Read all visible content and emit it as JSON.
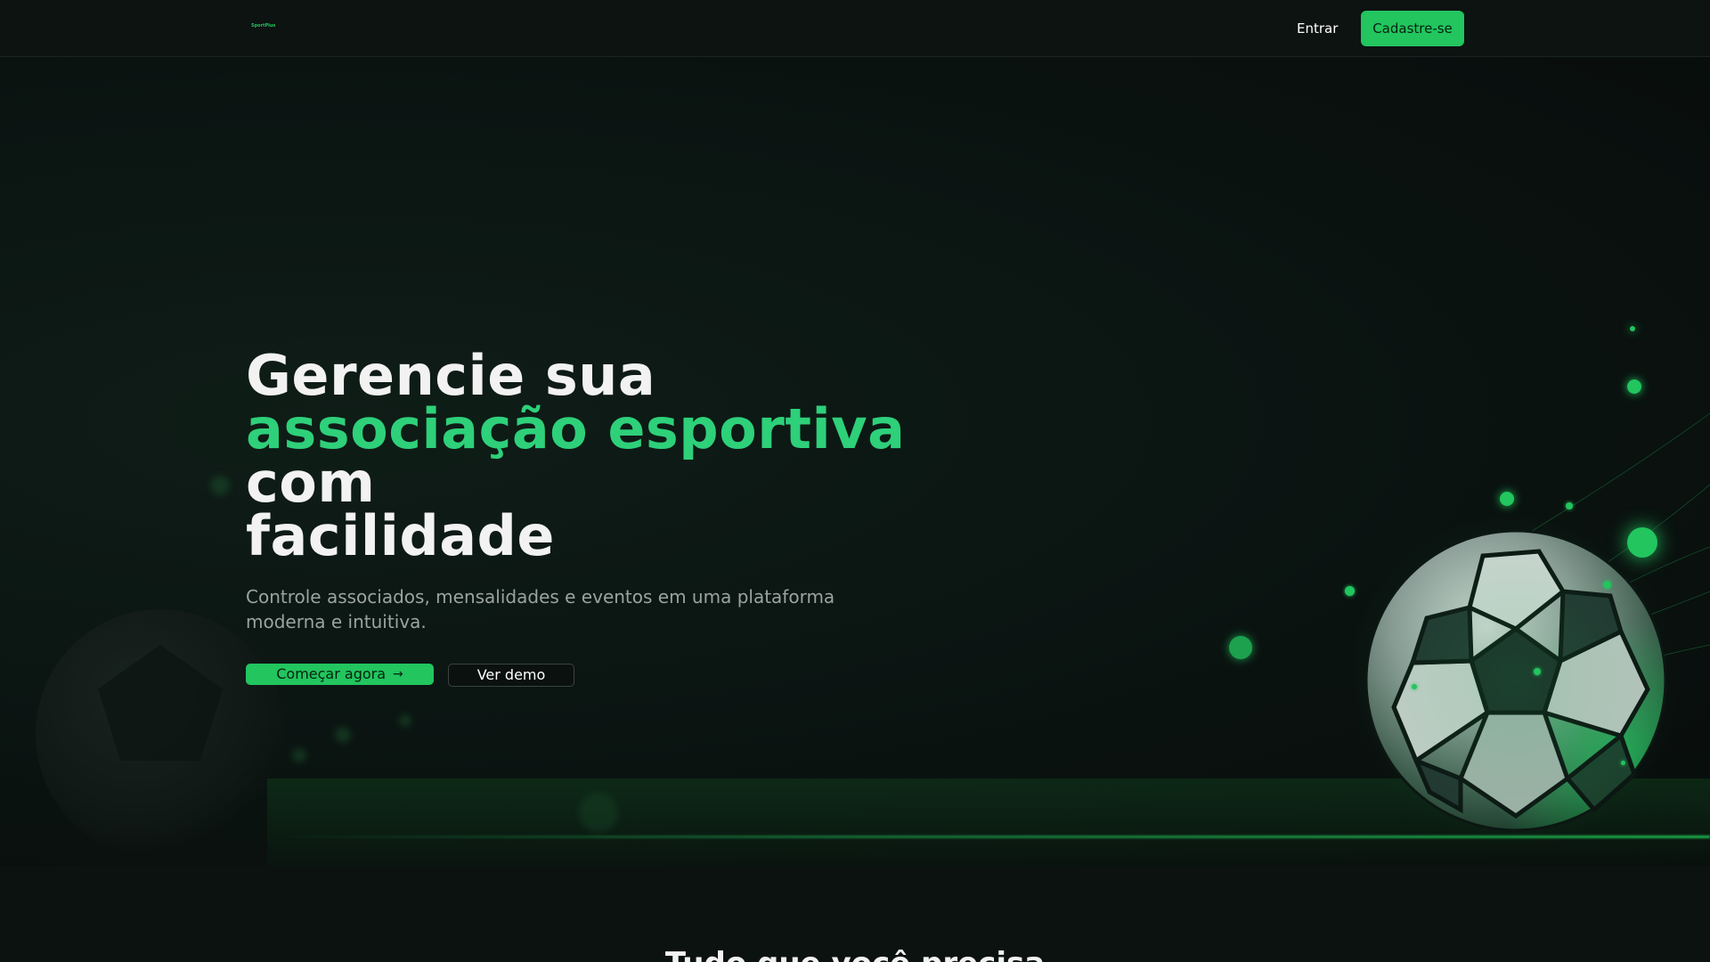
{
  "navbar": {
    "logo_text": "SportPlus",
    "login_label": "Entrar",
    "signup_label": "Cadastre-se"
  },
  "hero": {
    "title_line1": "Gerencie sua",
    "title_accent": "associação esportiva",
    "title_after_accent": "com",
    "title_line4": "facilidade",
    "subtitle": "Controle associados, mensalidades e eventos em uma plataforma moderna e intuitiva.",
    "primary_button_label": "Começar agora",
    "primary_button_icon": "arrow-right-icon",
    "secondary_button_label": "Ver demo"
  },
  "features": {
    "heading": "Tudo que você precisa"
  },
  "colors": {
    "background": "#0b1210",
    "accent": "#22c55e",
    "accent_text": "#2ed07a",
    "text_primary": "#f2f2f2",
    "text_secondary": "#9aa3a0"
  }
}
